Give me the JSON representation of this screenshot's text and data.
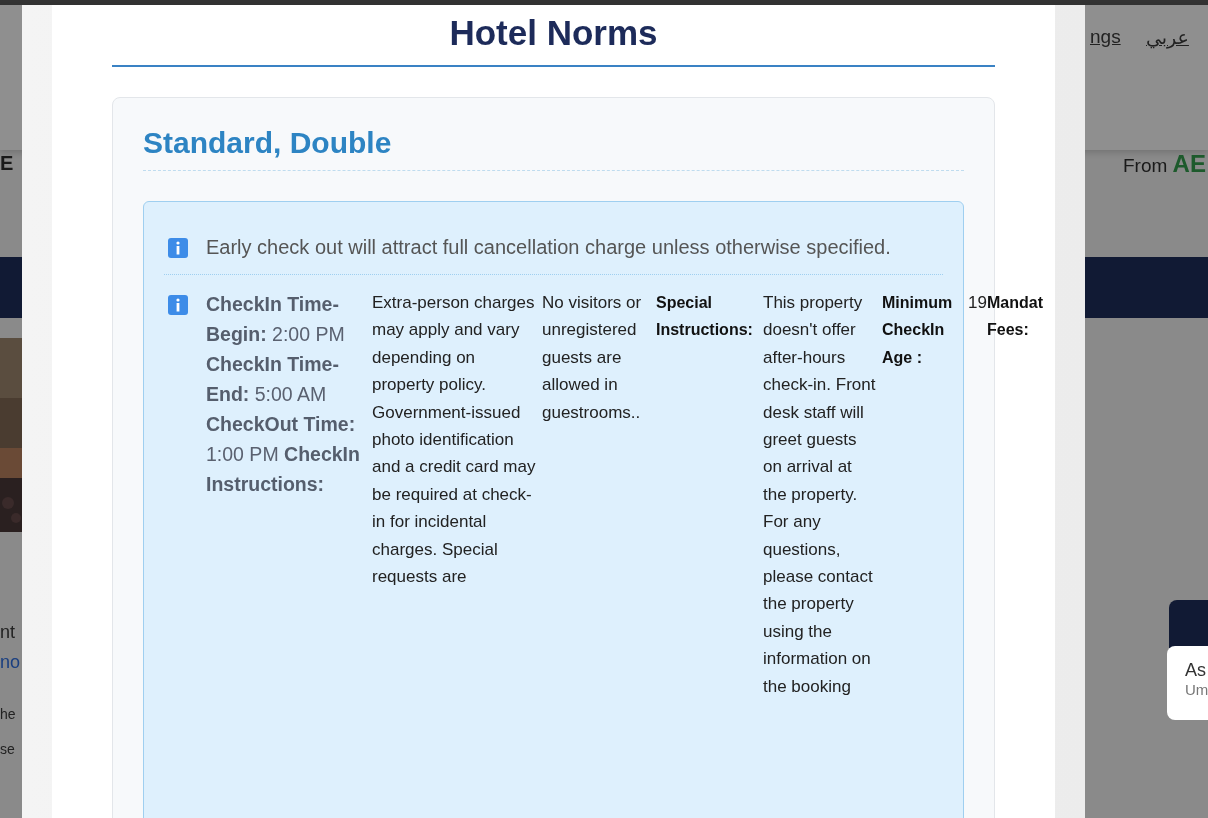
{
  "background": {
    "nav_link": "ngs",
    "language": "عربي",
    "heading_fragment": "E",
    "price_label": "From",
    "price_fragment": "AE",
    "text_fragments": [
      {
        "kind": "heading",
        "text": "nt"
      },
      {
        "kind": "link",
        "text": "no"
      },
      {
        "kind": "small",
        "text": "he"
      },
      {
        "kind": "small",
        "text": "se"
      }
    ],
    "popup": {
      "title": "As",
      "subtitle": "Um"
    }
  },
  "modal": {
    "title": "Hotel Norms",
    "room": {
      "name": "Standard, Double",
      "notes": [
        {
          "kind": "text",
          "text": "Early check out will attract full cancellation charge unless otherwise specified."
        },
        {
          "kind": "columns",
          "columns": [
            {
              "kind": "details",
              "text": "**CheckIn Time-Begin:** 2:00 PM **CheckIn Time-End:** 5:00 AM **CheckOut Time:** 1:00 PM **CheckIn Instructions:**"
            },
            {
              "kind": "value",
              "text": "Extra-person charges may apply and vary depending on property policy. Government-issued photo identification and a credit card may be required at check-in for incidental charges. Special requests are"
            },
            {
              "kind": "value",
              "text": "No visitors or unregistered guests are allowed in guestrooms.."
            },
            {
              "kind": "label",
              "text": "Special Instructions:"
            },
            {
              "kind": "value",
              "text": "This property doesn't offer after-hours check-in. Front desk staff will greet guests on arrival at the property. For any questions, please contact the property using the information on the booking"
            },
            {
              "kind": "label",
              "text": "Minimum CheckIn Age :"
            },
            {
              "kind": "value",
              "text": "19"
            },
            {
              "kind": "label",
              "text": "Mandat Fees:"
            }
          ]
        }
      ]
    }
  }
}
